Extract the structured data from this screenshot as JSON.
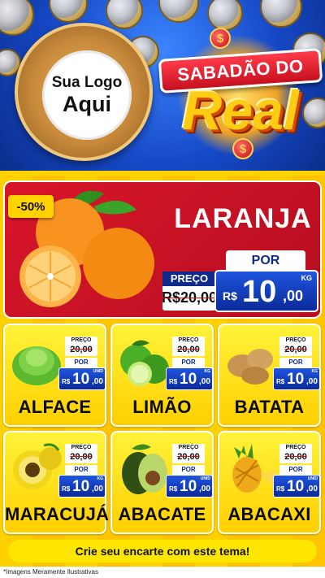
{
  "logo": {
    "line1": "Sua Logo",
    "line2": "Aqui"
  },
  "brand": {
    "top": "SABADÃO DO",
    "big": "Real",
    "coin_symbol": "$"
  },
  "featured": {
    "discount": "-50%",
    "name": "LARANJA",
    "old_label": "PREÇO",
    "old_price": "R$20,00",
    "por_label": "POR",
    "currency": "R$",
    "price_int": "10",
    "price_dec": ",00",
    "unit": "KG"
  },
  "products": [
    {
      "name": "ALFACE",
      "icon": "lettuce-icon",
      "old_label": "PREÇO",
      "old_price": "20,00",
      "por_label": "POR",
      "currency": "R$",
      "price_int": "10",
      "price_dec": ",00",
      "unit": "UNID"
    },
    {
      "name": "LIMÃO",
      "icon": "lime-icon",
      "old_label": "PREÇO",
      "old_price": "20,00",
      "por_label": "POR",
      "currency": "R$",
      "price_int": "10",
      "price_dec": ",00",
      "unit": "KG"
    },
    {
      "name": "BATATA",
      "icon": "potato-icon",
      "old_label": "PREÇO",
      "old_price": "20,00",
      "por_label": "POR",
      "currency": "R$",
      "price_int": "10",
      "price_dec": ",00",
      "unit": "KG"
    },
    {
      "name": "MARACUJÁ",
      "icon": "passion-fruit-icon",
      "old_label": "PREÇO",
      "old_price": "20,00",
      "por_label": "POR",
      "currency": "R$",
      "price_int": "10",
      "price_dec": ",00",
      "unit": "KG"
    },
    {
      "name": "ABACATE",
      "icon": "avocado-icon",
      "old_label": "PREÇO",
      "old_price": "20,00",
      "por_label": "POR",
      "currency": "R$",
      "price_int": "10",
      "price_dec": ",00",
      "unit": "UNID"
    },
    {
      "name": "ABACAXI",
      "icon": "pineapple-icon",
      "old_label": "PREÇO",
      "old_price": "20,00",
      "por_label": "POR",
      "currency": "R$",
      "price_int": "10",
      "price_dec": ",00",
      "unit": "UNID"
    }
  ],
  "cta": "Crie seu encarte com este tema!",
  "footnote": "*Imagens Meramente Ilustrativas",
  "colors": {
    "brand_blue": "#1649c8",
    "red": "#d9162a",
    "yellow": "#ffd200",
    "price_blue": "#0b2a99"
  }
}
